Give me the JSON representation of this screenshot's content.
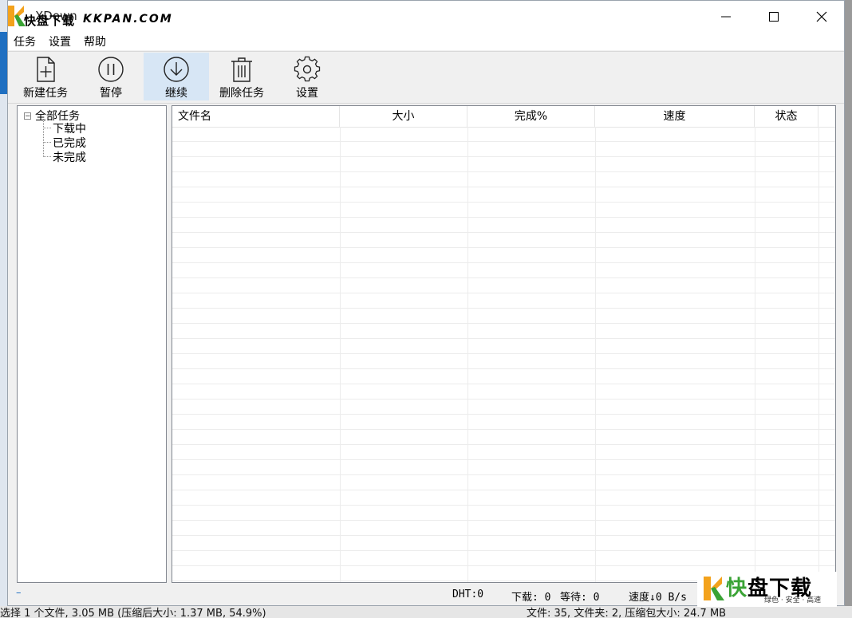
{
  "window": {
    "title_back": "XDown",
    "title_front": "快盘下载",
    "title_url": "KKPAN.COM"
  },
  "menu": {
    "items": [
      "任务",
      "设置",
      "帮助"
    ]
  },
  "toolbar": {
    "buttons": [
      {
        "label": "新建任务",
        "icon": "new-file-icon"
      },
      {
        "label": "暂停",
        "icon": "pause-icon"
      },
      {
        "label": "继续",
        "icon": "download-icon"
      },
      {
        "label": "删除任务",
        "icon": "trash-icon"
      },
      {
        "label": "设置",
        "icon": "gear-icon"
      }
    ]
  },
  "tree": {
    "root": "全部任务",
    "expander": "−",
    "children": [
      "下载中",
      "已完成",
      "未完成"
    ]
  },
  "list": {
    "columns": [
      "文件名",
      "大小",
      "完成%",
      "速度",
      "状态"
    ],
    "rows": []
  },
  "status": {
    "left": "–",
    "dht": "DHT:0",
    "download": "下载: 0",
    "waiting": "等待: 0",
    "speed": "速度↓0 B/s"
  },
  "watermark": {
    "brand_first": "快",
    "brand_rest": "盘下载",
    "tagline": "绿色 · 安全 · 高速"
  },
  "background": {
    "bottom_left": "选择 1 个文件, 3.05 MB (压缩后大小: 1.37 MB, 54.9%)",
    "bottom_right": "文件: 35, 文件夹: 2, 压缩包大小: 24.7 MB"
  },
  "colors": {
    "accent": "#1f6fc1",
    "active_button": "#d7e6f5",
    "logo_orange": "#f3a21c",
    "logo_green": "#3aa335"
  }
}
